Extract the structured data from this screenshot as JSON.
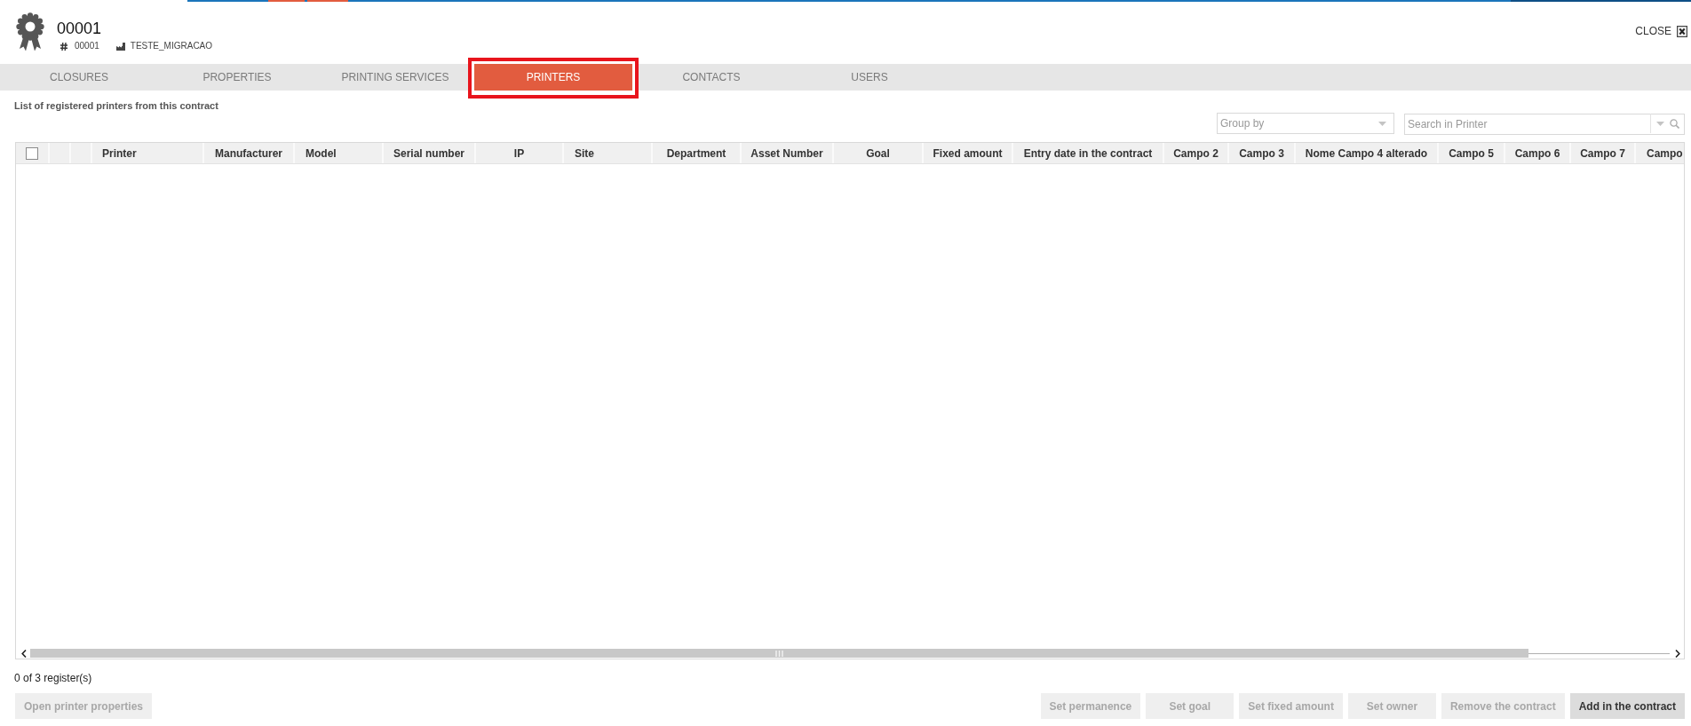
{
  "header": {
    "title": "00001",
    "code": "00001",
    "company": "TESTE_MIGRACAO",
    "close_label": "CLOSE"
  },
  "tabs": [
    {
      "label": "CLOSURES",
      "selected": false,
      "highlighted": false
    },
    {
      "label": "PROPERTIES",
      "selected": false,
      "highlighted": false
    },
    {
      "label": "PRINTING SERVICES",
      "selected": false,
      "highlighted": false
    },
    {
      "label": "PRINTERS",
      "selected": true,
      "highlighted": true
    },
    {
      "label": "CONTACTS",
      "selected": false,
      "highlighted": false
    },
    {
      "label": "USERS",
      "selected": false,
      "highlighted": false
    }
  ],
  "description": "List of registered printers from this contract",
  "group_by": {
    "placeholder": "Group by"
  },
  "search": {
    "placeholder": "Search in Printer"
  },
  "table": {
    "select_all": {
      "checked": false
    },
    "columns": [
      "Printer",
      "Manufacturer",
      "Model",
      "Serial number",
      "IP",
      "Site",
      "Department",
      "Asset Number",
      "Goal",
      "Fixed amount",
      "Entry date in the contract",
      "Campo 2",
      "Campo 3",
      "Nome Campo 4 alterado",
      "Campo 5",
      "Campo 6",
      "Campo 7",
      "Campo"
    ]
  },
  "status": "0 of 3 register(s)",
  "left_buttons": [
    {
      "label": "Open printer properties",
      "disabled": true
    }
  ],
  "right_buttons": [
    {
      "label": "Set permanence",
      "disabled": true
    },
    {
      "label": "Set goal",
      "disabled": true
    },
    {
      "label": "Set fixed amount",
      "disabled": true
    },
    {
      "label": "Set owner",
      "disabled": true
    },
    {
      "label": "Remove the contract",
      "disabled": true
    },
    {
      "label": "Add in the contract",
      "disabled": false
    }
  ]
}
